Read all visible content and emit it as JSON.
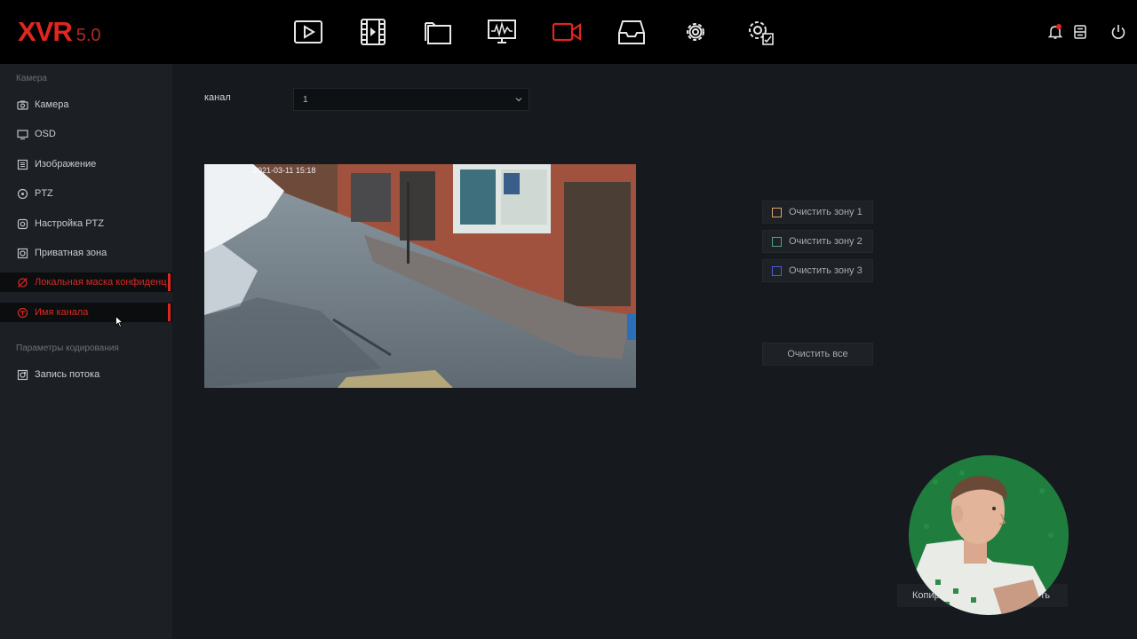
{
  "app": {
    "logo_main": "XVR",
    "logo_version": "5.0"
  },
  "topnav": [
    {
      "name": "playback-icon"
    },
    {
      "name": "video-film-icon"
    },
    {
      "name": "files-icon"
    },
    {
      "name": "monitor-icon"
    },
    {
      "name": "camera-icon",
      "active": true
    },
    {
      "name": "storage-icon"
    },
    {
      "name": "settings-gear-icon"
    },
    {
      "name": "system-settings-icon"
    }
  ],
  "topright": {
    "alert_icon": "bell-icon",
    "storage_icon": "disk-icon",
    "power_icon": "power-icon"
  },
  "colors": {
    "accent": "#e0261f",
    "topbar": "#000000",
    "sidebar": "#1c2025",
    "page": "#161a1f"
  },
  "sidebar": {
    "section1": "Камера",
    "items": [
      {
        "label": "Камера",
        "icon": "camera-icon"
      },
      {
        "label": "OSD",
        "icon": "monitor-icon"
      },
      {
        "label": "Изображение",
        "icon": "image-settings-icon"
      },
      {
        "label": "PTZ",
        "icon": "ptz-icon"
      },
      {
        "label": "Настройка PTZ",
        "icon": "ptz-setup-icon"
      },
      {
        "label": "Приватная зона",
        "icon": "privacy-zone-icon"
      },
      {
        "label": "Локальная маска конфиденц",
        "icon": "privacy-mask-icon",
        "active": true
      },
      {
        "label": "Имя канала",
        "icon": "channel-name-icon",
        "active": true
      }
    ],
    "section2": "Параметры кодирования",
    "items2": [
      {
        "label": "Запись потока",
        "icon": "stream-record-icon"
      }
    ]
  },
  "main": {
    "channel_label": "канал",
    "channel_value": "1",
    "video_timestamp": "2021-03-11 15:18",
    "zones": [
      {
        "label": "Очистить зону 1",
        "color": "#d9a46b"
      },
      {
        "label": "Очистить зону 2",
        "color": "#4fa37c"
      },
      {
        "label": "Очистить зону 3",
        "color": "#4b5bd6"
      }
    ],
    "clear_all": "Очистить все"
  },
  "footer": {
    "left_button": "Копир",
    "right_button": "ть"
  }
}
